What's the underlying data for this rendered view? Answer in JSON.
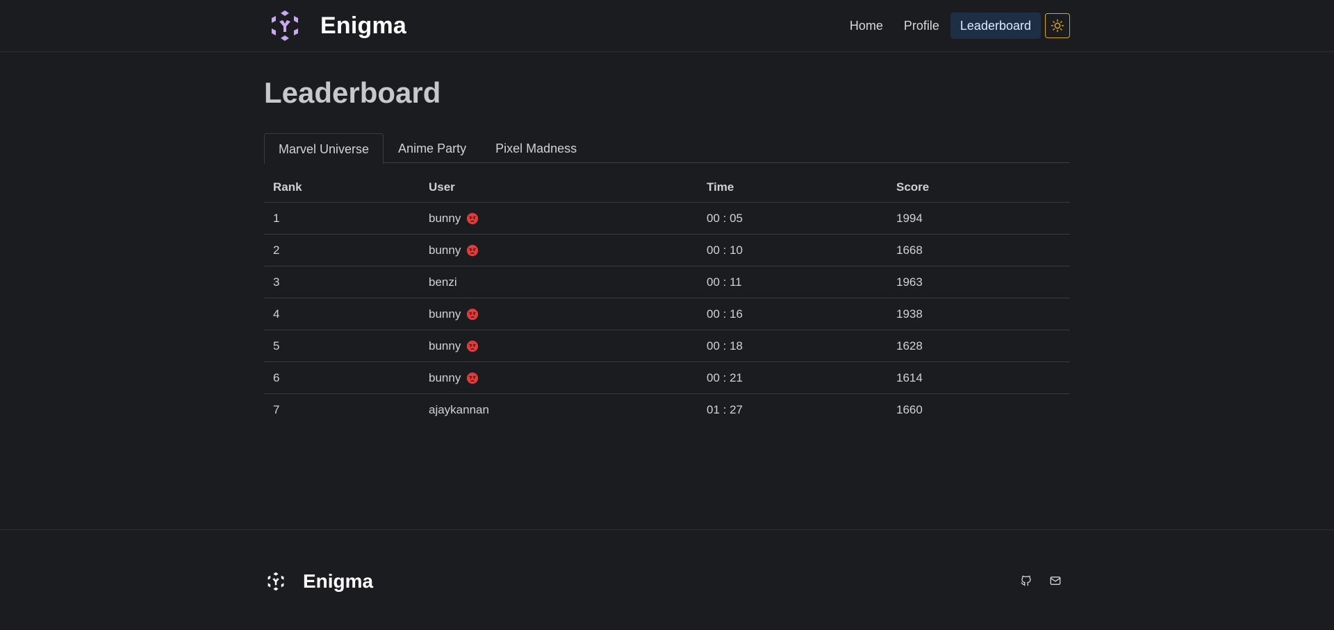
{
  "header": {
    "brand": "Enigma",
    "nav": [
      {
        "label": "Home"
      },
      {
        "label": "Profile"
      },
      {
        "label": "Leaderboard"
      }
    ],
    "active_nav": "Leaderboard",
    "theme_icon": "sun-icon"
  },
  "page": {
    "title": "Leaderboard"
  },
  "tabs": [
    {
      "label": "Marvel Universe"
    },
    {
      "label": "Anime Party"
    },
    {
      "label": "Pixel Madness"
    }
  ],
  "active_tab": "Marvel Universe",
  "table": {
    "columns": [
      "Rank",
      "User",
      "Time",
      "Score"
    ],
    "rows": [
      {
        "rank": "1",
        "user": "bunny",
        "badge": "angry-face-emoji",
        "time": "00 : 05",
        "score": "1994"
      },
      {
        "rank": "2",
        "user": "bunny",
        "badge": "angry-face-emoji",
        "time": "00 : 10",
        "score": "1668"
      },
      {
        "rank": "3",
        "user": "benzi",
        "badge": null,
        "time": "00 : 11",
        "score": "1963"
      },
      {
        "rank": "4",
        "user": "bunny",
        "badge": "angry-face-emoji",
        "time": "00 : 16",
        "score": "1938"
      },
      {
        "rank": "5",
        "user": "bunny",
        "badge": "angry-face-emoji",
        "time": "00 : 18",
        "score": "1628"
      },
      {
        "rank": "6",
        "user": "bunny",
        "badge": "angry-face-emoji",
        "time": "00 : 21",
        "score": "1614"
      },
      {
        "rank": "7",
        "user": "ajaykannan",
        "badge": null,
        "time": "01 : 27",
        "score": "1660"
      }
    ]
  },
  "footer": {
    "brand": "Enigma",
    "icons": [
      "github-icon",
      "mail-icon"
    ]
  },
  "colors": {
    "background": "#1b1c20",
    "brand_purple": "#c9a8f0",
    "active_nav_bg": "#1c2f45",
    "theme_accent": "#d4a72c",
    "emoji_red": "#e23b3b"
  }
}
